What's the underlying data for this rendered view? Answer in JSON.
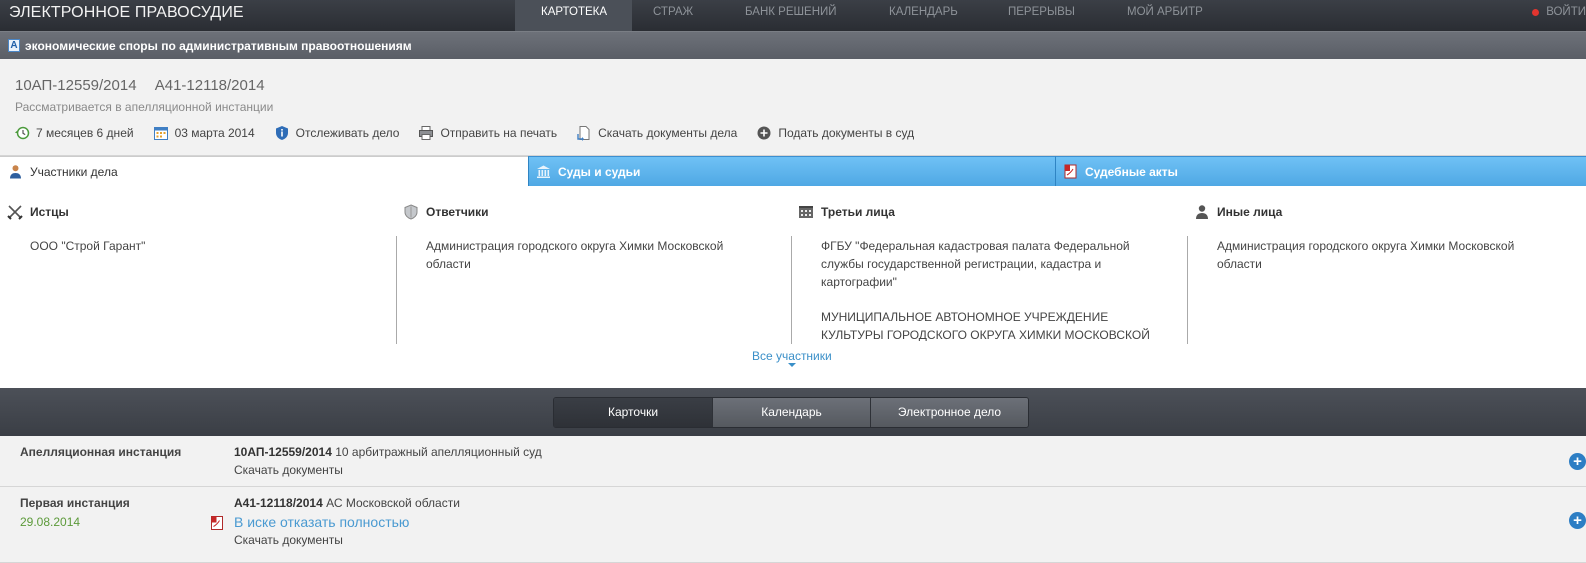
{
  "topbar": {
    "brand": "ЭЛЕКТРОННОЕ ПРАВОСУДИЕ",
    "nav": [
      {
        "label": "КАРТОТЕКА",
        "active": true
      },
      {
        "label": "СТРАЖ",
        "active": false
      },
      {
        "label": "БАНК РЕШЕНИЙ",
        "active": false
      },
      {
        "label": "КАЛЕНДАРЬ",
        "active": false
      },
      {
        "label": "ПЕРЕРЫВЫ",
        "active": false
      },
      {
        "label": "МОЙ АРБИТР",
        "active": false
      }
    ],
    "login_label": "ВОЙТИ"
  },
  "category": {
    "letter": "А",
    "title": "экономические споры по административным правоотношениям"
  },
  "case": {
    "number_appeal": "10АП-12559/2014",
    "number_first": "А41-12118/2014",
    "status": "Рассматривается в апелляционной инстанции",
    "actions": [
      {
        "icon": "clock-history-icon",
        "label": "7 месяцев 6 дней"
      },
      {
        "icon": "calendar-icon",
        "label": "03 марта 2014"
      },
      {
        "icon": "shield-info-icon",
        "label": "Отслеживать дело"
      },
      {
        "icon": "printer-icon",
        "label": "Отправить на печать"
      },
      {
        "icon": "download-document-icon",
        "label": "Скачать документы дела"
      },
      {
        "icon": "plus-circle-icon",
        "label": "Подать документы в суд"
      }
    ]
  },
  "tabs": [
    {
      "label": "Участники дела",
      "icon": "person-icon",
      "active": true
    },
    {
      "label": "Суды и судьи",
      "icon": "courthouse-icon",
      "active": false
    },
    {
      "label": "Судебные акты",
      "icon": "pdf-icon",
      "active": false
    }
  ],
  "participants": {
    "plaintiffs": {
      "title": "Истцы",
      "items": [
        "ООО \"Строй Гарант\""
      ]
    },
    "defendants": {
      "title": "Ответчики",
      "items": [
        "Администрация городского округа Химки Московской области"
      ]
    },
    "third_parties": {
      "title": "Третьи лица",
      "items": [
        "ФГБУ \"Федеральная кадастровая палата Федеральной службы государственной регистрации, кадастра и картографии\"",
        "МУНИЦИПАЛЬНОЕ АВТОНОМНОЕ УЧРЕЖДЕНИЕ КУЛЬТУРЫ ГОРОДСКОГО ОКРУГА ХИМКИ МОСКОВСКОЙ"
      ]
    },
    "others": {
      "title": "Иные лица",
      "items": [
        "Администрация городского округа Химки Московской области"
      ]
    },
    "all_link": "Все участники"
  },
  "view_tabs": [
    {
      "label": "Карточки",
      "active": true
    },
    {
      "label": "Календарь",
      "active": false
    },
    {
      "label": "Электронное дело",
      "active": false
    }
  ],
  "instances": [
    {
      "label": "Апелляционная инстанция",
      "case_number": "10АП-12559/2014",
      "court": "10 арбитражный апелляционный суд",
      "download": "Скачать документы"
    },
    {
      "label": "Первая инстанция",
      "date": "29.08.2014",
      "case_number": "А41-12118/2014",
      "court": "АС Московской области",
      "decision": "В иске отказать полностью",
      "download": "Скачать документы"
    }
  ],
  "colors": {
    "accent_blue": "#4fa8e4",
    "link_blue": "#4a9ad1",
    "date_green": "#5c9a3a",
    "login_dot": "#e2352f"
  }
}
